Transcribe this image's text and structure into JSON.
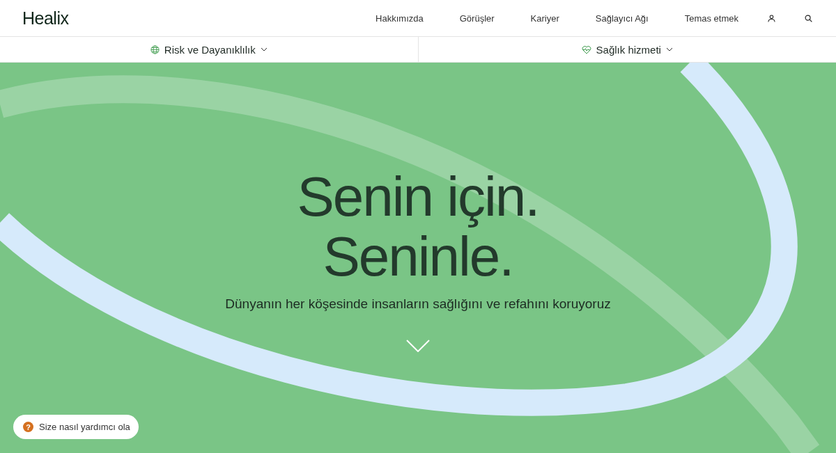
{
  "header": {
    "logo": "Healix",
    "nav": [
      "Hakkımızda",
      "Görüşler",
      "Kariyer",
      "Sağlayıcı Ağı",
      "Temas etmek"
    ]
  },
  "subnav": [
    {
      "kind": "globe",
      "label": "Risk ve Dayanıklılık"
    },
    {
      "kind": "heart",
      "label": "Sağlık hizmeti"
    }
  ],
  "hero": {
    "title_lines": [
      "Senin için.",
      "Seninle."
    ],
    "subtitle": "Dünyanın her köşesinde insanların sağlığını ve refahını koruyoruz"
  },
  "chat": {
    "icon": "?",
    "label": "Size nasıl yardımcı ola"
  }
}
